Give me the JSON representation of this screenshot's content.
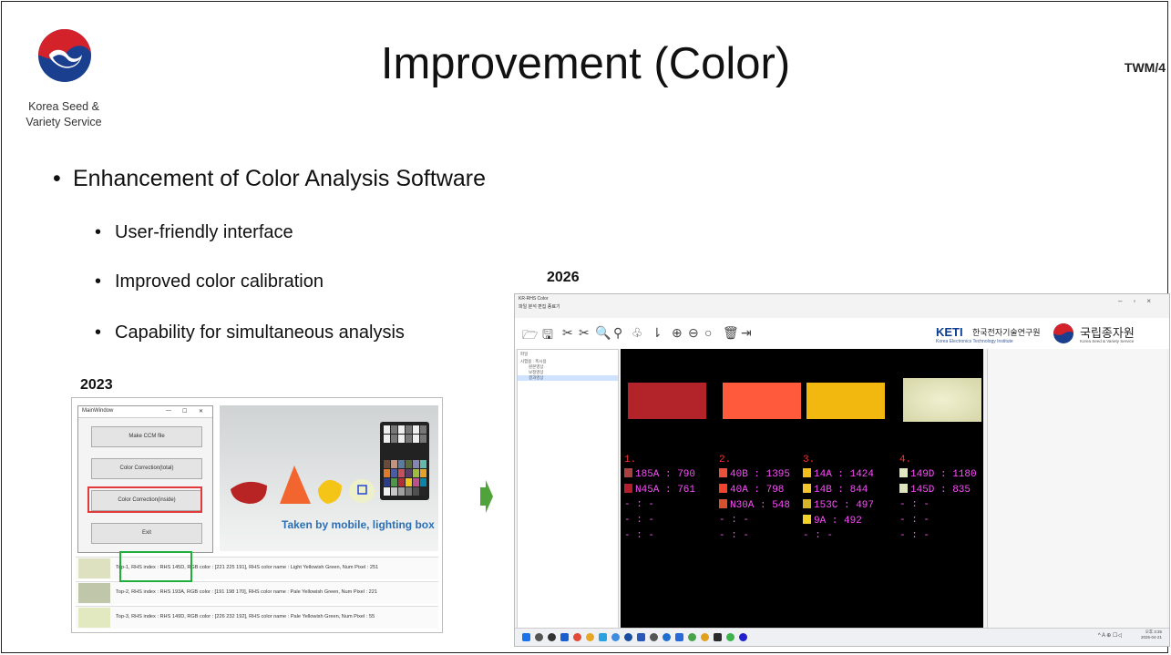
{
  "header": {
    "org_line1": "Korea Seed &",
    "org_line2": "Variety Service",
    "title": "Improvement (Color)",
    "doc_id": "TWM/4"
  },
  "bullets": {
    "main": "Enhancement of Color Analysis Software",
    "sub": [
      "User-friendly interface",
      "Improved color calibration",
      "Capability for simultaneous analysis"
    ]
  },
  "old_app": {
    "year": "2023",
    "window_title": "MainWindow",
    "buttons": [
      "Make CCM file",
      "Color Correction(total)",
      "Color Correction(inside)",
      "Exit"
    ],
    "caption": "Taken by mobile, lighting box",
    "results": [
      {
        "text": "Top-1, RHS index : RHS 145D, RGB color : [221 225 191], RHS color name : Light Yellowish Green, Num Pixel : 251",
        "color": "#dde1bf"
      },
      {
        "text": "Top-2, RHS index : RHS 193A, RGB color : [191 198 170], RHS color name : Pale Yellowish Green, Num Pixel : 221",
        "color": "#bfc6aa"
      },
      {
        "text": "Top-3, RHS index : RHS 149D, RGB color : [226 232 192], RHS color name : Pale Yellowish Green, Num Pixel : 55",
        "color": "#e2e8c0"
      }
    ],
    "highlight_color": "#1fae3a",
    "selected_button_color": "#e23a3a"
  },
  "new_app": {
    "year": "2026",
    "window_title": "KR-RHS Color",
    "menu": "파일  분석  편집  종료기",
    "brand_keti": "KETI",
    "brand_keti_kr": "한국전자기술연구원",
    "brand_keti_en": "Korea Electronics Technology Institute",
    "brand_kss_kr": "국립종자원",
    "brand_kss_en": "Korea Seed & Variety Service",
    "tree_items": [
      "파일",
      "시험용 : 폭시용",
      "원본영상",
      "보정영상",
      "결과영상"
    ],
    "sections": [
      {
        "num": "1.",
        "patch": "#b3232a",
        "rows": [
          {
            "t": "185A : 790",
            "c": "#a8413f"
          },
          {
            "t": "N45A : 761",
            "c": "#b1202c"
          },
          {
            "t": "- : -",
            "c": null
          },
          {
            "t": "- : -",
            "c": null
          },
          {
            "t": "- : -",
            "c": null
          }
        ]
      },
      {
        "num": "2.",
        "patch": "#ff5a3c",
        "rows": [
          {
            "t": "40B : 1395",
            "c": "#e8523c"
          },
          {
            "t": "40A : 798",
            "c": "#f0442e"
          },
          {
            "t": "N30A : 548",
            "c": "#d7502f"
          },
          {
            "t": "- : -",
            "c": null
          },
          {
            "t": "- : -",
            "c": null
          }
        ]
      },
      {
        "num": "3.",
        "patch": "#f2b80f",
        "rows": [
          {
            "t": "14A : 1424",
            "c": "#f3bd1c"
          },
          {
            "t": "14B : 844",
            "c": "#f4c52e"
          },
          {
            "t": "153C : 497",
            "c": "#d6b628"
          },
          {
            "t": "9A : 492",
            "c": "#f4d22a"
          },
          {
            "t": "- : -",
            "c": null
          }
        ]
      },
      {
        "num": "4.",
        "patch": "#e6e6bf",
        "rows": [
          {
            "t": "149D : 1180",
            "c": "#e3e7c0"
          },
          {
            "t": "145D : 835",
            "c": "#dfe3bd"
          },
          {
            "t": "- : -",
            "c": null
          },
          {
            "t": "- : -",
            "c": null
          },
          {
            "t": "- : -",
            "c": null
          }
        ]
      }
    ],
    "clock": "오후 3:35",
    "date": "2026-04-21"
  }
}
